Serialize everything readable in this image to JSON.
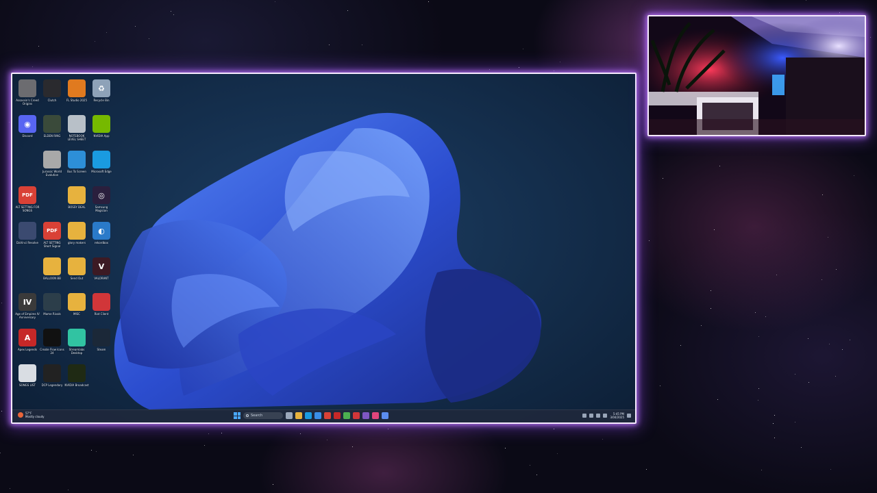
{
  "desktop": {
    "icons": [
      {
        "label": "Assassin's Creed Origins",
        "color": "#6c6c70",
        "glyph": "",
        "name": "assassins-creed-icon"
      },
      {
        "label": "Clutch",
        "color": "#2a2a2e",
        "glyph": "",
        "name": "clutch-icon"
      },
      {
        "label": "FL Studio 2025",
        "color": "#e07a1f",
        "glyph": "",
        "name": "fl-studio-icon"
      },
      {
        "label": "Recycle Bin",
        "color": "#8ea2b8",
        "glyph": "♻",
        "name": "recycle-bin-icon"
      },
      {
        "label": "Discord",
        "color": "#5865f2",
        "glyph": "◉",
        "name": "discord-icon"
      },
      {
        "label": "ELDEN RING",
        "color": "#3a4a3a",
        "glyph": "",
        "name": "elden-ring-icon"
      },
      {
        "label": "NOTEBOOK LEVEL SHEET",
        "color": "#b8c0c8",
        "glyph": "",
        "name": "notebook-icon"
      },
      {
        "label": "NVIDIA App",
        "color": "#76b900",
        "glyph": "",
        "name": "nvidia-app-icon"
      },
      {
        "label": "",
        "color": "",
        "glyph": "",
        "name": "empty-slot",
        "empty": true
      },
      {
        "label": "Jurassic World Evolution",
        "color": "#a9a9a9",
        "glyph": "",
        "name": "jurassic-world-icon"
      },
      {
        "label": "Bus To Screen",
        "color": "#2d8fd8",
        "glyph": "",
        "name": "bus-to-screen-icon"
      },
      {
        "label": "Microsoft Edge",
        "color": "#1a9be0",
        "glyph": "",
        "name": "microsoft-edge-icon"
      },
      {
        "label": "ALT SETTING FOR SONGS",
        "color": "#d94136",
        "glyph": "PDF",
        "name": "pdf-icon"
      },
      {
        "label": "",
        "color": "",
        "glyph": "",
        "name": "empty-slot",
        "empty": true
      },
      {
        "label": "BOSSY DEAL",
        "color": "#e7b23e",
        "glyph": "",
        "name": "folder-icon"
      },
      {
        "label": "Samsung Magician",
        "color": "#2a1f3d",
        "glyph": "◎",
        "name": "samsung-magician-icon"
      },
      {
        "label": "DaVinci Resolve",
        "color": "#3b4a70",
        "glyph": "",
        "name": "davinci-resolve-icon"
      },
      {
        "label": "ALT SETTING Short Signal",
        "color": "#d94136",
        "glyph": "PDF",
        "name": "pdf-icon"
      },
      {
        "label": "glory makers",
        "color": "#e7b23e",
        "glyph": "",
        "name": "folder-icon"
      },
      {
        "label": "rekordbox",
        "color": "#2a7ac9",
        "glyph": "◐",
        "name": "rekordbox-icon"
      },
      {
        "label": "",
        "color": "",
        "glyph": "",
        "name": "empty-slot",
        "empty": true
      },
      {
        "label": "BALLOON BB",
        "color": "#e7b23e",
        "glyph": "",
        "name": "folder-icon"
      },
      {
        "label": "Send Out",
        "color": "#e7b23e",
        "glyph": "",
        "name": "folder-icon"
      },
      {
        "label": "VALORANT",
        "color": "#3c1a24",
        "glyph": "V",
        "name": "valorant-icon"
      },
      {
        "label": "Age of Empires IV Anniversary Edition",
        "color": "#3a3a3a",
        "glyph": "IV",
        "name": "age-of-empires-icon"
      },
      {
        "label": "Mame Rivals",
        "color": "#2c3e4a",
        "glyph": "",
        "name": "mame-rivals-icon"
      },
      {
        "label": "MISC",
        "color": "#e7b23e",
        "glyph": "",
        "name": "folder-icon"
      },
      {
        "label": "Riot Client",
        "color": "#d13639",
        "glyph": "",
        "name": "riot-client-icon"
      },
      {
        "label": "Apex Legends",
        "color": "#c62828",
        "glyph": "A",
        "name": "apex-legends-icon"
      },
      {
        "label": "Create Flow Icons 24",
        "color": "#111111",
        "glyph": "",
        "name": "app-icon"
      },
      {
        "label": "Streamlabs Desktop",
        "color": "#31c3a2",
        "glyph": "",
        "name": "streamlabs-icon"
      },
      {
        "label": "Steam",
        "color": "#1b2838",
        "glyph": "",
        "name": "steam-icon"
      },
      {
        "label": "SONGS LIST",
        "color": "#d9dde3",
        "glyph": "",
        "name": "document-icon"
      },
      {
        "label": "DCP Legendary",
        "color": "#222222",
        "glyph": "",
        "name": "dcp-icon"
      },
      {
        "label": "NVIDIA Broadcast",
        "color": "#1f2a14",
        "glyph": "",
        "name": "nvidia-broadcast-icon"
      }
    ]
  },
  "taskbar": {
    "weather_temp": "57°F",
    "weather_desc": "Mostly cloudy",
    "search_placeholder": "Search",
    "time": "5:45 PM",
    "date": "3/04/2025",
    "apps": [
      {
        "name": "task-view-icon",
        "color": "#9aa7ba"
      },
      {
        "name": "file-explorer-icon",
        "color": "#e7b23e"
      },
      {
        "name": "edge-icon",
        "color": "#1a9be0"
      },
      {
        "name": "store-icon",
        "color": "#3a8ee6"
      },
      {
        "name": "app-icon",
        "color": "#d94136"
      },
      {
        "name": "app-icon",
        "color": "#c62828"
      },
      {
        "name": "chrome-icon",
        "color": "#4caf50"
      },
      {
        "name": "app-icon",
        "color": "#d13639"
      },
      {
        "name": "app-icon",
        "color": "#7e57c2"
      },
      {
        "name": "app-icon",
        "color": "#e0457b"
      },
      {
        "name": "app-icon",
        "color": "#5b8def"
      }
    ]
  },
  "colors": {
    "neon_border": "#f6eaff",
    "neon_glow": "#b478ff",
    "bloom": "#2f5fe0"
  }
}
